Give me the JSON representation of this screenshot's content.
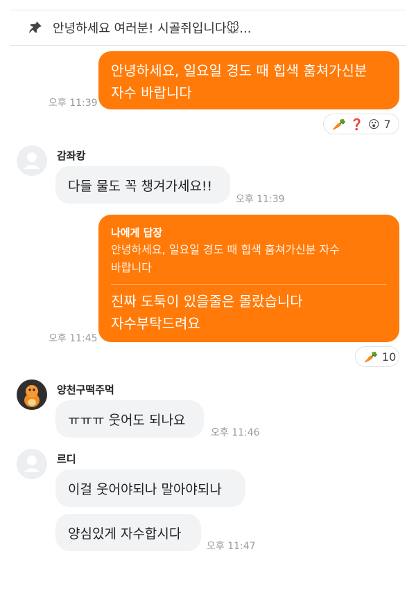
{
  "pinned": {
    "text": "안녕하세요 여러분! 시골쥐입니다🐭...",
    "icon": "pin-icon"
  },
  "messages": [
    {
      "id": "m1",
      "direction": "out",
      "lines": [
        "안녕하세요, 일요일 경도 때 힙색 훔쳐가신분",
        "자수 바랍니다"
      ],
      "time": "오후 11:39",
      "reactions": {
        "emoji": [
          "🥕",
          "❓",
          "😮"
        ],
        "count": "7"
      }
    },
    {
      "id": "m2",
      "direction": "in",
      "sender": "감좌캉",
      "avatar": "default-avatar",
      "text": "다들 물도 꼭 챙겨가세요!!",
      "time": "오후 11:39"
    },
    {
      "id": "m3",
      "direction": "out",
      "reply": {
        "label": "나에게 답장",
        "quote": [
          "안녕하세요, 일요일 경도 때 힙색 훔쳐가신분 자수",
          "바랍니다"
        ]
      },
      "lines": [
        "진짜 도둑이 있을줄은 몰랐습니다",
        "자수부탁드려요"
      ],
      "time": "오후 11:45",
      "reactions": {
        "emoji": [
          "🥕"
        ],
        "count": "10"
      }
    },
    {
      "id": "m4",
      "direction": "in",
      "sender": "양천구떡주먹",
      "avatar": "charmander-avatar",
      "text": "ㅠㅠㅠ 웃어도 되나요",
      "time": "오후 11:46"
    },
    {
      "id": "m5",
      "direction": "in",
      "sender": "르디",
      "avatar": "default-avatar",
      "texts": [
        "이걸 웃어야되나 말아야되나",
        "양심있게 자수합시다"
      ],
      "time": "오후 11:47"
    }
  ],
  "colors": {
    "outgoing_bubble": "#ff7a08",
    "incoming_bubble": "#f2f3f5",
    "time_text": "#9a9a9a"
  }
}
